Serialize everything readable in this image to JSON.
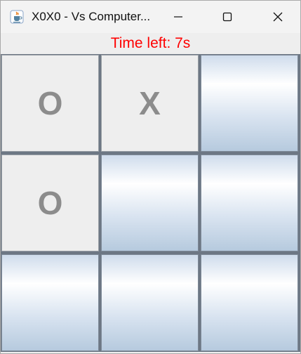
{
  "window": {
    "title": "X0X0 - Vs Computer...",
    "minimize_glyph": "—",
    "maximize_glyph": "☐",
    "close_glyph": "✕"
  },
  "game": {
    "timer_text": "Time left: 7s",
    "board": [
      [
        "O",
        "X",
        ""
      ],
      [
        "O",
        "",
        ""
      ],
      [
        "",
        "",
        ""
      ]
    ]
  },
  "colors": {
    "timer": "#ff0000",
    "mark": "#8c8c8c"
  },
  "icons": {
    "app": "java-cup-icon"
  }
}
